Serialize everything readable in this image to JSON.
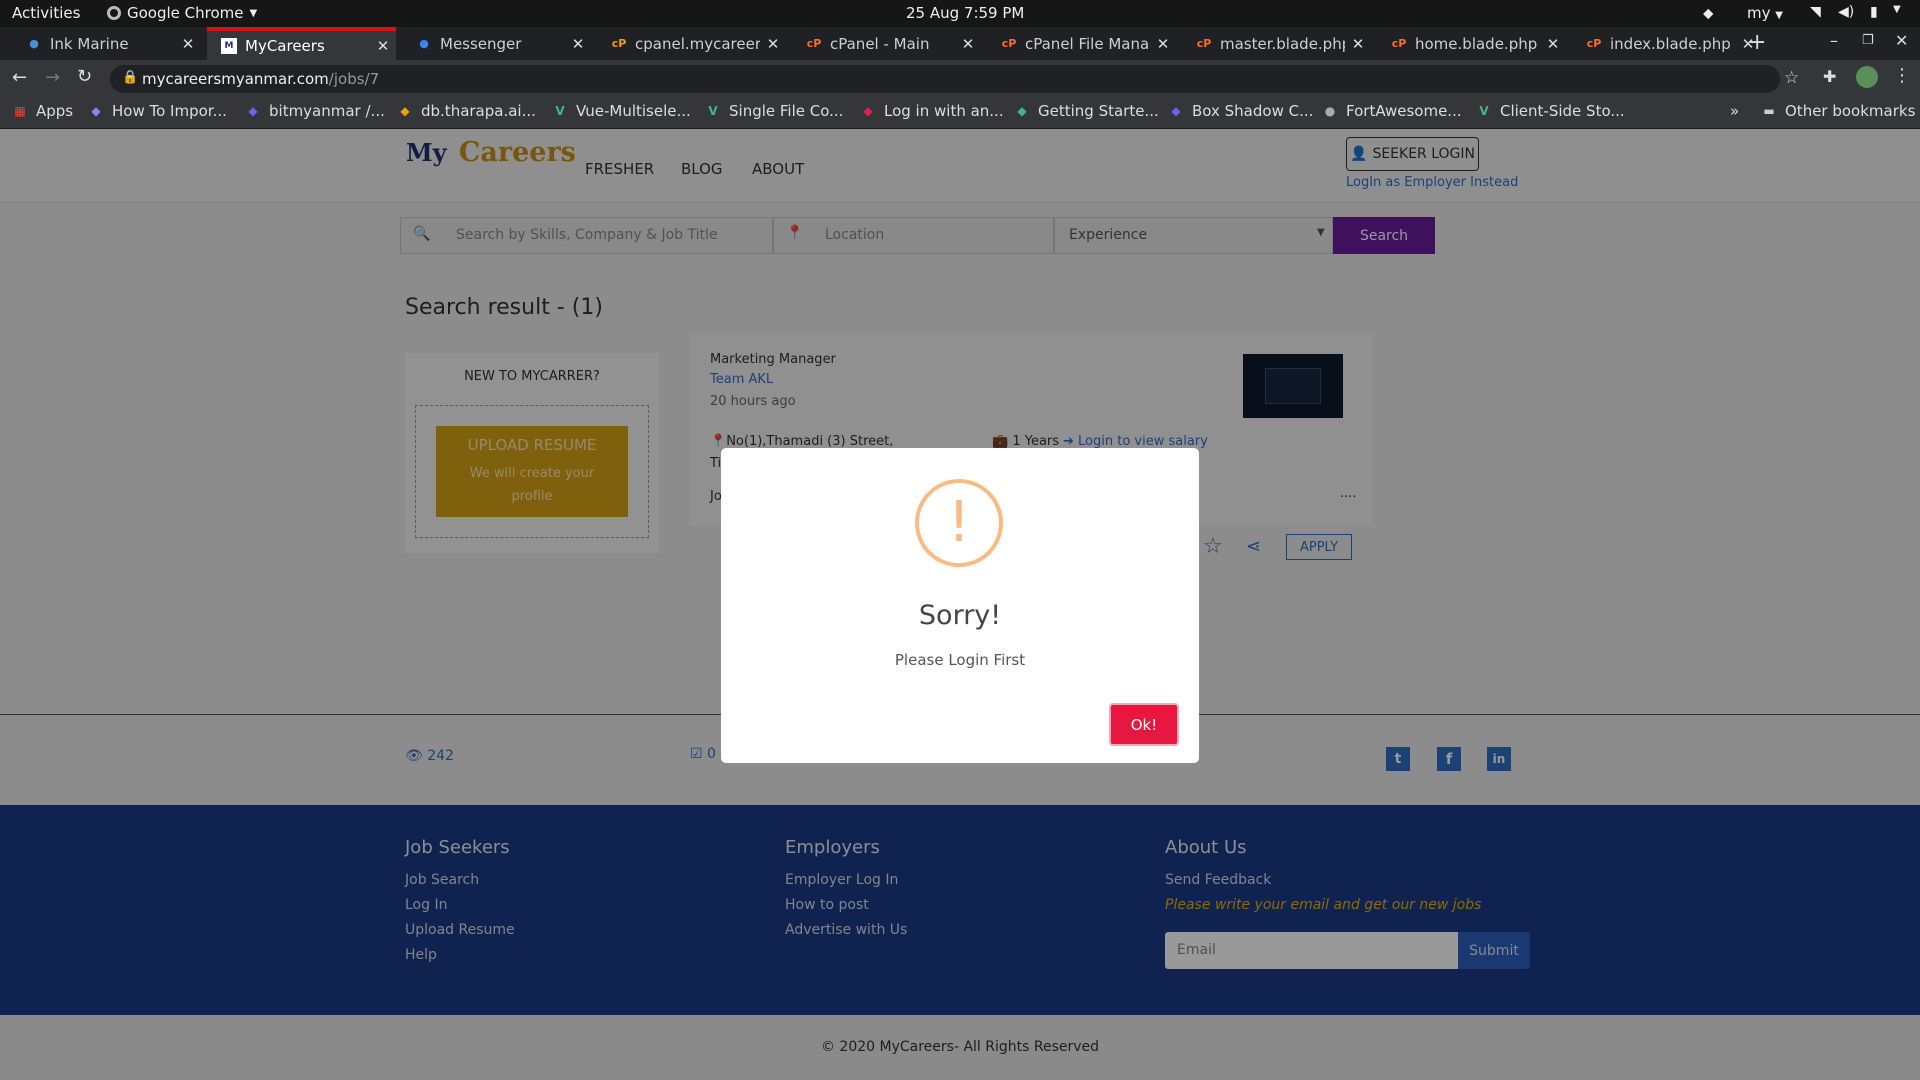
{
  "gnome": {
    "activities": "Activities",
    "app": "Google Chrome",
    "datetime": "25 Aug  7:59 PM",
    "lang": "my"
  },
  "tabs": [
    {
      "title": "Ink Marine",
      "fav": "globe-icon",
      "color": "#4a90d9",
      "active": false
    },
    {
      "title": "MyCareers",
      "fav": "mycareers-icon",
      "color": "#ffffff",
      "active": true
    },
    {
      "title": "Messenger",
      "fav": "messenger-icon",
      "color": "#3b82f6",
      "active": false
    },
    {
      "title": "cpanel.mycareersm",
      "fav": "cpanel-icon",
      "color": "#f59e0b",
      "active": false
    },
    {
      "title": "cPanel - Main",
      "fav": "cpanel-icon",
      "color": "#ff6c2c",
      "active": false
    },
    {
      "title": "cPanel File Manage",
      "fav": "cpanel-icon",
      "color": "#ff6c2c",
      "active": false
    },
    {
      "title": "master.blade.php - c",
      "fav": "cpanel-icon",
      "color": "#ff6c2c",
      "active": false
    },
    {
      "title": "home.blade.php - c",
      "fav": "cpanel-icon",
      "color": "#ff6c2c",
      "active": false
    },
    {
      "title": "index.blade.php - c",
      "fav": "cpanel-icon",
      "color": "#ff6c2c",
      "active": false
    }
  ],
  "address": {
    "url_host": "mycareersmyanmar.com",
    "url_path": "/jobs/7"
  },
  "bookmarks": [
    {
      "label": "Apps",
      "icon": "apps-icon",
      "color": "#ea4335"
    },
    {
      "label": "How To Impor...",
      "icon": "bookmark-icon",
      "color": "#7c8cf8"
    },
    {
      "label": "bitmyanmar /...",
      "icon": "bookmark-icon",
      "color": "#6366f1"
    },
    {
      "label": "db.tharapa.ai...",
      "icon": "bookmark-icon",
      "color": "#f59e0b"
    },
    {
      "label": "Vue-Multisele...",
      "icon": "vue-icon",
      "color": "#41b883"
    },
    {
      "label": "Single File Co...",
      "icon": "vue-icon",
      "color": "#41b883"
    },
    {
      "label": "Log in with an...",
      "icon": "bookmark-icon",
      "color": "#e11d48"
    },
    {
      "label": "Getting Starte...",
      "icon": "bookmark-icon",
      "color": "#41b883"
    },
    {
      "label": "Box Shadow C...",
      "icon": "bookmark-icon",
      "color": "#6366f1"
    },
    {
      "label": "FortAwesome...",
      "icon": "github-icon",
      "color": "#aaaaaa"
    },
    {
      "label": "Client-Side Sto...",
      "icon": "vue-icon",
      "color": "#41b883"
    }
  ],
  "bookmarks_other": "Other bookmarks",
  "site": {
    "logo_my": "My",
    "logo_rest": "Careers",
    "nav": [
      "FRESHER",
      "BLOG",
      "ABOUT"
    ],
    "seeker_login": "SEEKER LOGIN",
    "employer_login": "LogIn as Employer Instead"
  },
  "search": {
    "skills_placeholder": "Search by Skills, Company & Job Title",
    "location_placeholder": "Location",
    "experience": "Experience",
    "button": "Search"
  },
  "results": {
    "title": "Search result - (1)"
  },
  "new_box": {
    "title": "NEW TO MYCARRER?",
    "upload": "UPLOAD RESUME",
    "upload_sub": "We will create your profile"
  },
  "job": {
    "title": "Marketing Manager",
    "company": "Team AKL",
    "time": "20 hours ago",
    "address": "No(1),Thamadi (3) Street,",
    "address2": "Ti",
    "experience": "1 Years",
    "salary": "Login to view salary",
    "desc": "Jo",
    "more": "....",
    "apply": "APPLY"
  },
  "stats": {
    "views": "242",
    "applied": "0"
  },
  "footer": {
    "seekers_title": "Job Seekers",
    "seekers": [
      "Job Search",
      "Log In",
      "Upload Resume",
      "Help"
    ],
    "employers_title": "Employers",
    "employers": [
      "Employer Log In",
      "How to post",
      "Advertise with Us"
    ],
    "about_title": "About Us",
    "feedback": "Send Feedback",
    "note": "Please write your email and get our new jobs",
    "email_placeholder": "Email",
    "submit": "Submit",
    "copyright": "© 2020 MyCareers- All Rights Reserved"
  },
  "modal": {
    "title": "Sorry!",
    "message": "Please Login First",
    "ok": "Ok!"
  },
  "colors": {
    "accent": "#6a1b9a",
    "gold": "#d4a017",
    "link": "#2c6fc7",
    "footer": "#1b3a84",
    "danger": "#e8173f"
  }
}
